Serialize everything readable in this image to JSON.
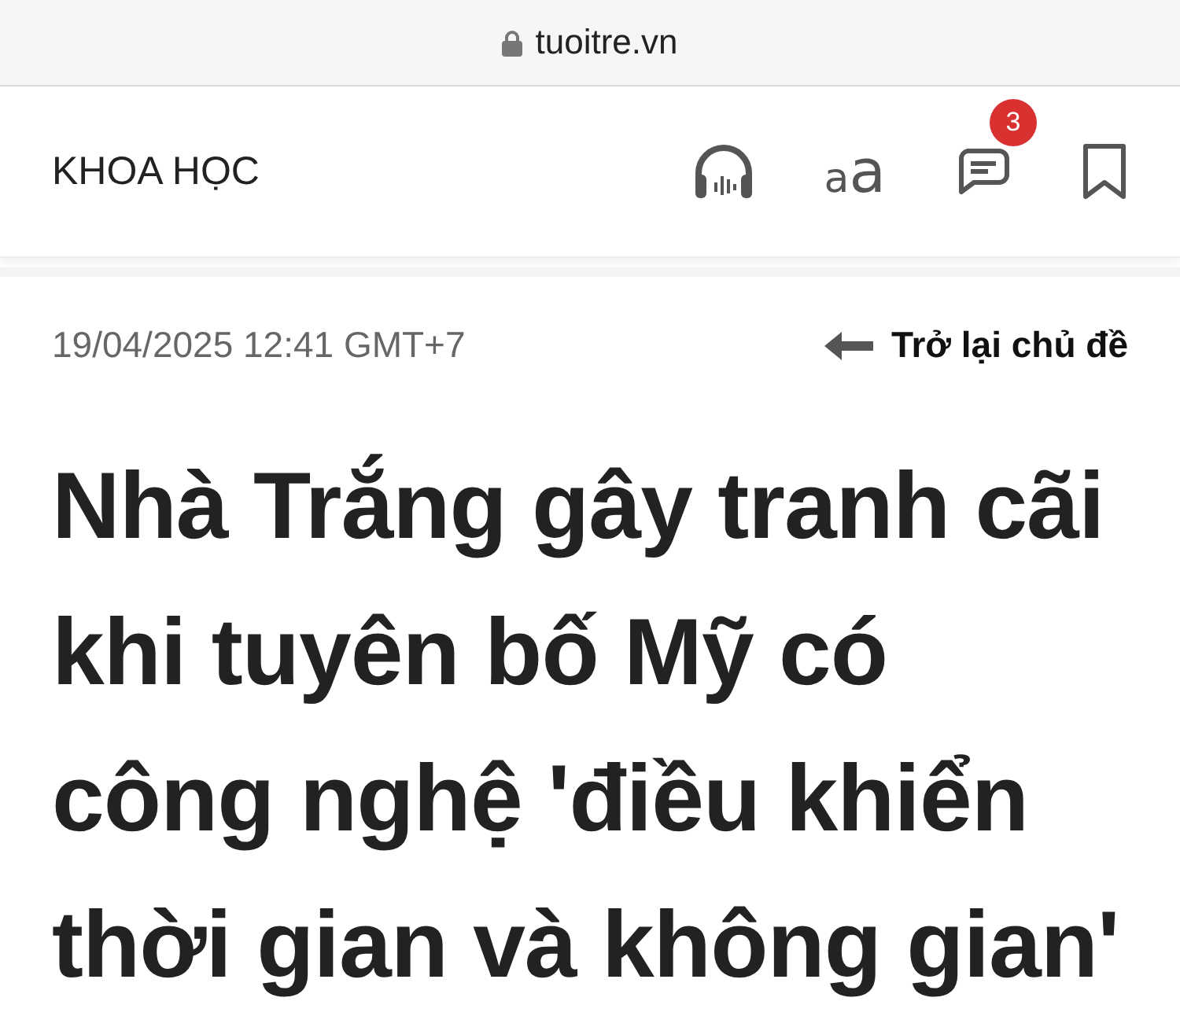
{
  "browser": {
    "url": "tuoitre.vn"
  },
  "header": {
    "section": "KHOA HỌC",
    "font_size": {
      "small": "a",
      "large": "a"
    },
    "comment_count": "3"
  },
  "article": {
    "date": "19/04/2025 12:41 GMT+7",
    "back_link": "Trở lại chủ đề",
    "title_lines": [
      "Nhà Trắng gây tranh cãi",
      "khi tuyên bố Mỹ có",
      "công nghệ 'điều khiển",
      "thời gian và không gian'"
    ]
  }
}
